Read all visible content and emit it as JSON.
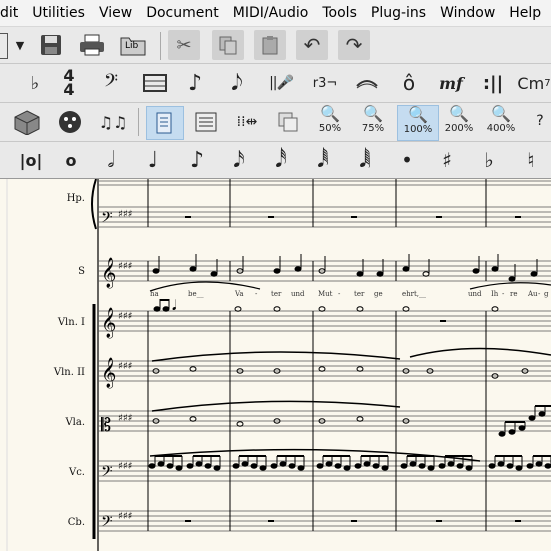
{
  "menu": [
    "dit",
    "Utilities",
    "View",
    "Document",
    "MIDI/Audio",
    "Tools",
    "Plug-ins",
    "Window",
    "Help"
  ],
  "toolbar3_zoom": [
    "50%",
    "75%",
    "100%",
    "200%",
    "400%"
  ],
  "zoom_selected": "100%",
  "toolbar1_icons": [
    "dropdown-icon",
    "save-icon",
    "print-icon",
    "library-icon",
    "cut-icon",
    "copy-icon",
    "paste-icon",
    "undo-icon",
    "redo-icon"
  ],
  "library_label": "Lib",
  "toolbar2": {
    "chord_label": "Cm",
    "chord_sup": "7",
    "dynamic_label": "mf",
    "tuplet_label": "r3¬"
  },
  "instruments": [
    "Hp.",
    "S",
    "Vln. I",
    "Vln. II",
    "Vla.",
    "Vc.",
    "Cb."
  ],
  "lyrics": [
    "ha",
    "be__",
    "Va",
    "-",
    "ter",
    "und",
    "Mut",
    "-",
    "ter",
    "ge",
    "ehrt,__",
    "und",
    "Ih",
    "-",
    "re",
    "Au",
    "-",
    "g"
  ],
  "colors": {
    "score_bg": "#fbf8ee",
    "selected_zoom": "#c5dcf0"
  }
}
